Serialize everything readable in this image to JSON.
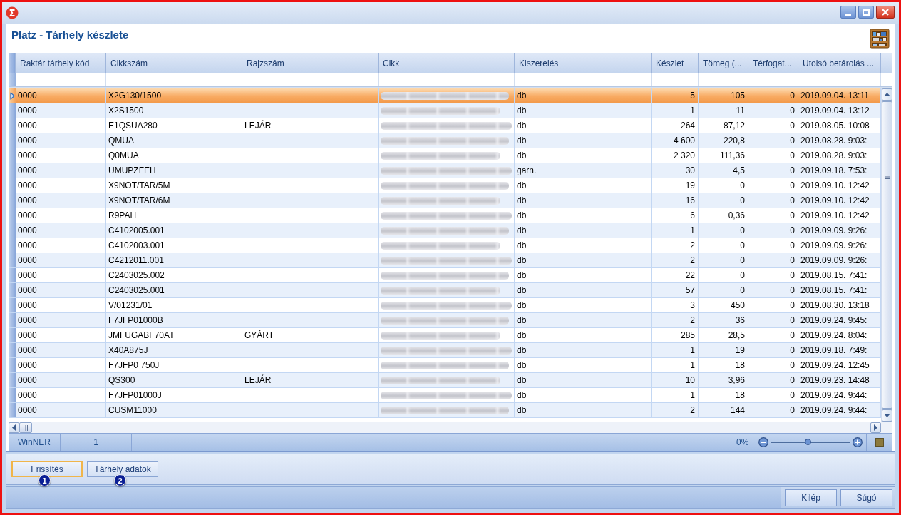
{
  "header": {
    "title": "Platz - Tárhely készlete"
  },
  "table": {
    "columns": [
      {
        "label": "Raktár tárhely kód",
        "kind": "text"
      },
      {
        "label": "Cikkszám",
        "kind": "text"
      },
      {
        "label": "Rajzszám",
        "kind": "text"
      },
      {
        "label": "Cikk",
        "kind": "blurred"
      },
      {
        "label": "Kiszerelés",
        "kind": "text"
      },
      {
        "label": "Készlet",
        "kind": "number"
      },
      {
        "label": "Tömeg (...",
        "kind": "number"
      },
      {
        "label": "Térfogat...",
        "kind": "number"
      },
      {
        "label": "Utolsó betárolás ...",
        "kind": "text"
      }
    ],
    "rows": [
      {
        "selected": true,
        "location": "0000",
        "item_no": "X2G130/1500",
        "unit": "db",
        "stock": "5",
        "weight": "105",
        "volume": "0",
        "last_stored": "2019.09.04. 13:11"
      },
      {
        "selected": false,
        "location": "0000",
        "item_no": "X2S1500",
        "unit": "db",
        "stock": "1",
        "weight": "11",
        "volume": "0",
        "last_stored": "2019.09.04. 13:12"
      },
      {
        "selected": false,
        "location": "0000",
        "item_no": "E1QSUA280",
        "drawing_no": "LEJÁR",
        "unit": "db",
        "stock": "264",
        "weight": "87,12",
        "volume": "0",
        "last_stored": "2019.08.05. 10:08"
      },
      {
        "selected": false,
        "location": "0000",
        "item_no": "QMUA",
        "unit": "db",
        "stock": "4 600",
        "weight": "220,8",
        "volume": "0",
        "last_stored": "2019.08.28. 9:03:"
      },
      {
        "selected": false,
        "location": "0000",
        "item_no": "Q0MUA",
        "unit": "db",
        "stock": "2 320",
        "weight": "111,36",
        "volume": "0",
        "last_stored": "2019.08.28. 9:03:"
      },
      {
        "selected": false,
        "location": "0000",
        "item_no": "UMUPZFEH",
        "unit": "garn.",
        "stock": "30",
        "weight": "4,5",
        "volume": "0",
        "last_stored": "2019.09.18. 7:53:"
      },
      {
        "selected": false,
        "location": "0000",
        "item_no": "X9NOT/TAR/5M",
        "unit": "db",
        "stock": "19",
        "weight": "0",
        "volume": "0",
        "last_stored": "2019.09.10. 12:42"
      },
      {
        "selected": false,
        "location": "0000",
        "item_no": "X9NOT/TAR/6M",
        "unit": "db",
        "stock": "16",
        "weight": "0",
        "volume": "0",
        "last_stored": "2019.09.10. 12:42"
      },
      {
        "selected": false,
        "location": "0000",
        "item_no": "R9PAH",
        "unit": "db",
        "stock": "6",
        "weight": "0,36",
        "volume": "0",
        "last_stored": "2019.09.10. 12:42"
      },
      {
        "selected": false,
        "location": "0000",
        "item_no": "C4102005.001",
        "unit": "db",
        "stock": "1",
        "weight": "0",
        "volume": "0",
        "last_stored": "2019.09.09. 9:26:"
      },
      {
        "selected": false,
        "location": "0000",
        "item_no": "C4102003.001",
        "unit": "db",
        "stock": "2",
        "weight": "0",
        "volume": "0",
        "last_stored": "2019.09.09. 9:26:"
      },
      {
        "selected": false,
        "location": "0000",
        "item_no": "C4212011.001",
        "unit": "db",
        "stock": "2",
        "weight": "0",
        "volume": "0",
        "last_stored": "2019.09.09. 9:26:"
      },
      {
        "selected": false,
        "location": "0000",
        "item_no": "C2403025.002",
        "unit": "db",
        "stock": "22",
        "weight": "0",
        "volume": "0",
        "last_stored": "2019.08.15. 7:41:"
      },
      {
        "selected": false,
        "location": "0000",
        "item_no": "C2403025.001",
        "unit": "db",
        "stock": "57",
        "weight": "0",
        "volume": "0",
        "last_stored": "2019.08.15. 7:41:"
      },
      {
        "selected": false,
        "location": "0000",
        "item_no": "V/01231/01",
        "unit": "db",
        "stock": "3",
        "weight": "450",
        "volume": "0",
        "last_stored": "2019.08.30. 13:18"
      },
      {
        "selected": false,
        "location": "0000",
        "item_no": "F7JFP01000B",
        "unit": "db",
        "stock": "2",
        "weight": "36",
        "volume": "0",
        "last_stored": "2019.09.24. 9:45:"
      },
      {
        "selected": false,
        "location": "0000",
        "item_no": "JMFUGABF70AT",
        "drawing_no": "GYÁRT",
        "unit": "db",
        "stock": "285",
        "weight": "28,5",
        "volume": "0",
        "last_stored": "2019.09.24. 8:04:"
      },
      {
        "selected": false,
        "location": "0000",
        "item_no": "X40A875J",
        "unit": "db",
        "stock": "1",
        "weight": "19",
        "volume": "0",
        "last_stored": "2019.09.18. 7:49:"
      },
      {
        "selected": false,
        "location": "0000",
        "item_no": "F7JFP0 750J",
        "unit": "db",
        "stock": "1",
        "weight": "18",
        "volume": "0",
        "last_stored": "2019.09.24. 12:45"
      },
      {
        "selected": false,
        "location": "0000",
        "item_no": "QS300",
        "drawing_no": "LEJÁR",
        "unit": "db",
        "stock": "10",
        "weight": "3,96",
        "volume": "0",
        "last_stored": "2019.09.23. 14:48"
      },
      {
        "selected": false,
        "location": "0000",
        "item_no": "F7JFP01000J",
        "unit": "db",
        "stock": "1",
        "weight": "18",
        "volume": "0",
        "last_stored": "2019.09.24. 9:44:"
      },
      {
        "selected": false,
        "location": "0000",
        "item_no": "CUSM11000",
        "unit": "db",
        "stock": "2",
        "weight": "144",
        "volume": "0",
        "last_stored": "2019.09.24. 9:44:"
      }
    ]
  },
  "status_bar": {
    "app_name": "WinNER",
    "record_count": "1",
    "zoom": {
      "reading": "0%",
      "level": 0.46
    }
  },
  "actions": [
    {
      "label": "Frissítés",
      "focused": true,
      "marker": "1"
    },
    {
      "label": "Tárhely adatok",
      "focused": false,
      "marker": "2"
    }
  ],
  "footer_buttons": [
    {
      "label": "Kilép"
    },
    {
      "label": "Súgó"
    }
  ]
}
